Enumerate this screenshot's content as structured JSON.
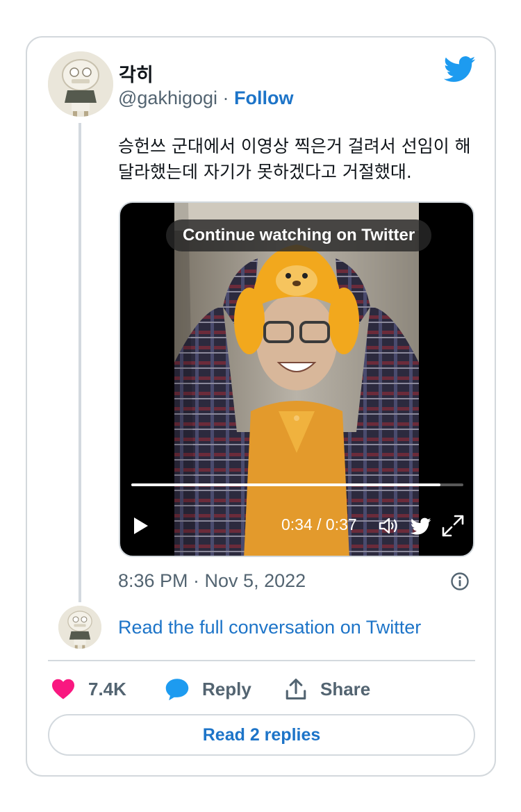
{
  "author": {
    "name": "각히",
    "handle": "@gakhigogi",
    "separator": "·",
    "follow_label": "Follow"
  },
  "tweet": {
    "text": "승헌쓰 군대에서 이영상 찍은거 걸려서 선임이 해달라했는데 자기가 못하겠다고 거절했대.",
    "timestamp": "8:36 PM · Nov 5, 2022"
  },
  "video": {
    "overlay_label": "Continue watching on Twitter",
    "time_display": "0:34 / 0:37",
    "progress": 0.93
  },
  "links": {
    "read_conversation": "Read the full conversation on Twitter"
  },
  "actions": {
    "like_count": "7.4K",
    "reply_label": "Reply",
    "share_label": "Share"
  },
  "footer": {
    "read_replies_label": "Read 2 replies"
  },
  "colors": {
    "brand_blue": "#1d9bf0",
    "link_blue": "#1d74c8",
    "like_pink": "#f91880",
    "muted_text": "#536471"
  },
  "icons": [
    "twitter-bird-icon",
    "play-icon",
    "volume-icon",
    "expand-icon",
    "info-icon",
    "heart-icon",
    "reply-bubble-icon",
    "share-icon"
  ]
}
